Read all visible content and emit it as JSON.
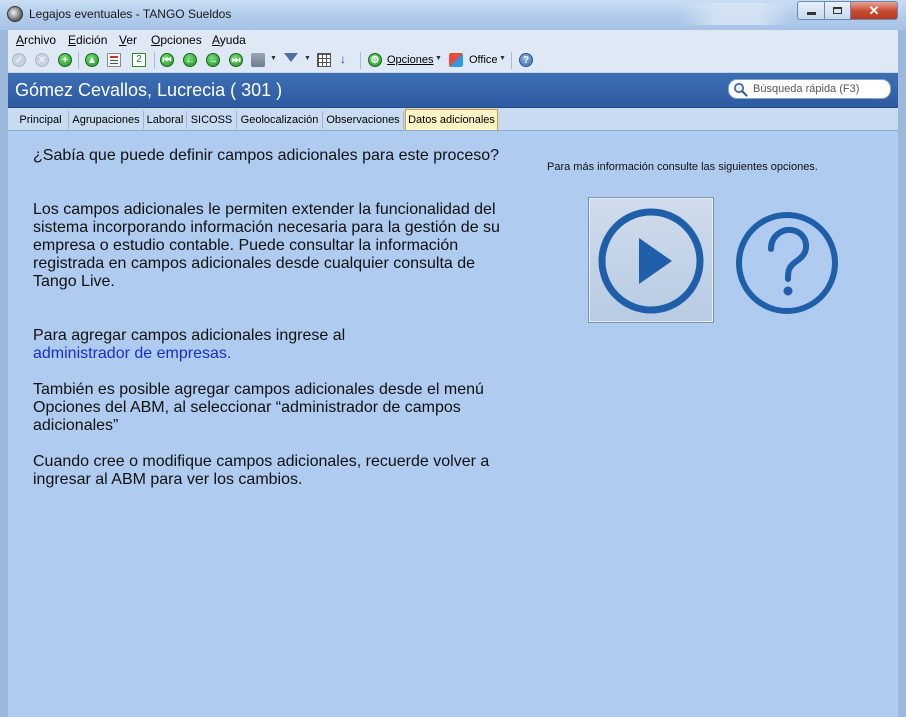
{
  "window": {
    "title": "Legajos eventuales - TANGO Sueldos",
    "close_glyph": "✕"
  },
  "menu": {
    "items": [
      {
        "label": "Archivo",
        "accel": "A",
        "rest": "rchivo"
      },
      {
        "label": "Edición",
        "accel": "E",
        "rest": "dición"
      },
      {
        "label": "Ver",
        "accel": "V",
        "rest": "er"
      },
      {
        "label": "Opciones",
        "accel": "O",
        "rest": "pciones"
      },
      {
        "label": "Ayuda",
        "accel": "A",
        "rest": "yuda"
      }
    ]
  },
  "toolbar": {
    "opciones_label": "Opciones",
    "office_label": "Office",
    "help_glyph": "?"
  },
  "header": {
    "title": "Gómez Cevallos, Lucrecia ( 301 )",
    "search_placeholder": "Búsqueda rápida (F3)"
  },
  "tabs": [
    {
      "label": "Principal"
    },
    {
      "label": "Agrupaciones"
    },
    {
      "label": "Laboral"
    },
    {
      "label": "SICOSS"
    },
    {
      "label": "Geolocalización"
    },
    {
      "label": "Observaciones"
    },
    {
      "label": "Datos adicionales",
      "active": true
    }
  ],
  "content": {
    "p1": "¿Sabía que puede definir campos adicionales para este proceso?",
    "p2": "Los campos adicionales le permiten extender la funcionalidad del sistema incorporando información necesaria para la gestión de su empresa o estudio contable. Puede consultar la información registrada en campos adicionales desde cualquier consulta de Tango Live.",
    "p3_text": "Para agregar campos adicionales ingrese al",
    "p3_link": "administrador de empresas.",
    "p4": "También es posible agregar campos adicionales desde el menú Opciones del ABM, al seleccionar “administrador de campos adicionales”",
    "p5": "Cuando cree o modifique campos adicionales, recuerde volver a ingresar al ABM para ver los cambios.",
    "info": "Para más información consulte las siguientes opciones."
  },
  "colors": {
    "accent_blue": "#2d5aa0",
    "content_bg": "#afcbef",
    "active_tab": "#fdf3c6",
    "icon_blue": "#1f5ea8",
    "link": "#1a2fc7"
  }
}
